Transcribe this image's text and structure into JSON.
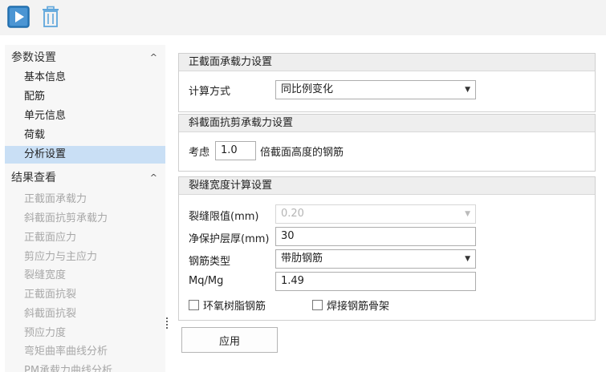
{
  "toolbar": {
    "run_icon": "play-icon",
    "delete_icon": "trash-icon"
  },
  "sidebar": {
    "params_group": "参数设置",
    "params_items": [
      "基本信息",
      "配筋",
      "单元信息",
      "荷载",
      "分析设置"
    ],
    "results_group": "结果查看",
    "results_items": [
      "正截面承载力",
      "斜截面抗剪承载力",
      "正截面应力",
      "剪应力与主应力",
      "裂缝宽度",
      "正截面抗裂",
      "斜截面抗裂",
      "预应力度",
      "弯矩曲率曲线分析",
      "PM承载力曲线分析"
    ],
    "active_item": "分析设置",
    "collapse_glyph": "^"
  },
  "normal_section": {
    "title": "正截面承载力设置",
    "calc_label": "计算方式",
    "calc_value": "同比例变化"
  },
  "shear": {
    "title": "斜截面抗剪承载力设置",
    "prefix": "考虑",
    "value": "1.0",
    "suffix": "倍截面高度的钢筋"
  },
  "crack": {
    "title": "裂缝宽度计算设置",
    "limit_label": "裂缝限值(mm)",
    "limit_value": "0.20",
    "cover_label": "净保护层厚(mm)",
    "cover_value": "30",
    "rebar_label": "钢筋类型",
    "rebar_value": "带肋钢筋",
    "ratio_label": "Mq/Mg",
    "ratio_value": "1.49",
    "epoxy_label": "环氧树脂钢筋",
    "weld_label": "焊接钢筋骨架"
  },
  "apply_label": "应用",
  "colors": {
    "accent": "#2f7fc1",
    "selected_bg": "#c9dff5",
    "disabled_text": "#a8a8a8"
  }
}
